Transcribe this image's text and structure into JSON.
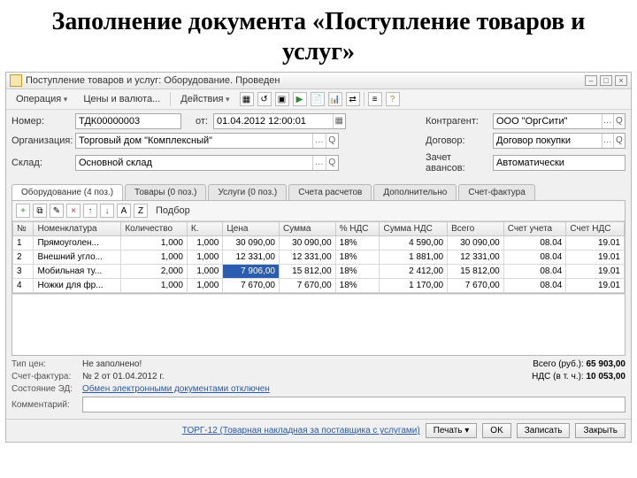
{
  "slide_title": "Заполнение документа «Поступление товаров и услуг»",
  "window_title": "Поступление товаров и услуг: Оборудование. Проведен",
  "menu": {
    "operation": "Операция",
    "prices": "Цены и валюта...",
    "actions": "Действия"
  },
  "form": {
    "number_lbl": "Номер:",
    "number": "ТДК00000003",
    "date_lbl": "от:",
    "date": "01.04.2012 12:00:01",
    "contragent_lbl": "Контрагент:",
    "contragent": "ООО \"ОргСити\"",
    "org_lbl": "Организация:",
    "org": "Торговый дом \"Комплексный\"",
    "contract_lbl": "Договор:",
    "contract": "Договор покупки",
    "warehouse_lbl": "Склад:",
    "warehouse": "Основной склад",
    "advance_lbl": "Зачет авансов:",
    "advance": "Автоматически"
  },
  "tabs": [
    "Оборудование (4 поз.)",
    "Товары (0 поз.)",
    "Услуги (0 поз.)",
    "Счета расчетов",
    "Дополнительно",
    "Счет-фактура"
  ],
  "gridbar_pick": "Подбор",
  "columns": [
    "№",
    "Номенклатура",
    "Количество",
    "К.",
    "Цена",
    "Сумма",
    "% НДС",
    "Сумма НДС",
    "Всего",
    "Счет учета",
    "Счет НДС"
  ],
  "rows": [
    {
      "n": "1",
      "name": "Прямоуголен...",
      "qty": "1,000",
      "k": "1,000",
      "price": "30 090,00",
      "sum": "30 090,00",
      "vatp": "18%",
      "vat": "4 590,00",
      "total": "30 090,00",
      "acc": "08.04",
      "accv": "19.01"
    },
    {
      "n": "2",
      "name": "Внешний угло...",
      "qty": "1,000",
      "k": "1,000",
      "price": "12 331,00",
      "sum": "12 331,00",
      "vatp": "18%",
      "vat": "1 881,00",
      "total": "12 331,00",
      "acc": "08.04",
      "accv": "19.01"
    },
    {
      "n": "3",
      "name": "Мобильная ту...",
      "qty": "2,000",
      "k": "1,000",
      "price": "7 906,00",
      "sum": "15 812,00",
      "vatp": "18%",
      "vat": "2 412,00",
      "total": "15 812,00",
      "acc": "08.04",
      "accv": "19.01"
    },
    {
      "n": "4",
      "name": "Ножки для фр...",
      "qty": "1,000",
      "k": "1,000",
      "price": "7 670,00",
      "sum": "7 670,00",
      "vatp": "18%",
      "vat": "1 170,00",
      "total": "7 670,00",
      "acc": "08.04",
      "accv": "19.01"
    }
  ],
  "footer": {
    "pricetype_lbl": "Тип цен:",
    "pricetype": "Не заполнено!",
    "invoice_lbl": "Счет-фактура:",
    "invoice": "№ 2 от 01.04.2012 г.",
    "edo_lbl": "Состояние ЭД:",
    "edo": "Обмен электронными документами отключен",
    "comment_lbl": "Комментарий:",
    "total_lbl": "Всего (руб.):",
    "total": "65 903,00",
    "vat_lbl": "НДС (в т. ч.):",
    "vat": "10 053,00"
  },
  "btnbar": {
    "torg": "ТОРГ-12 (Товарная накладная за поставщика с услугами)",
    "print": "Печать",
    "ok": "OK",
    "save": "Записать",
    "close": "Закрыть"
  }
}
